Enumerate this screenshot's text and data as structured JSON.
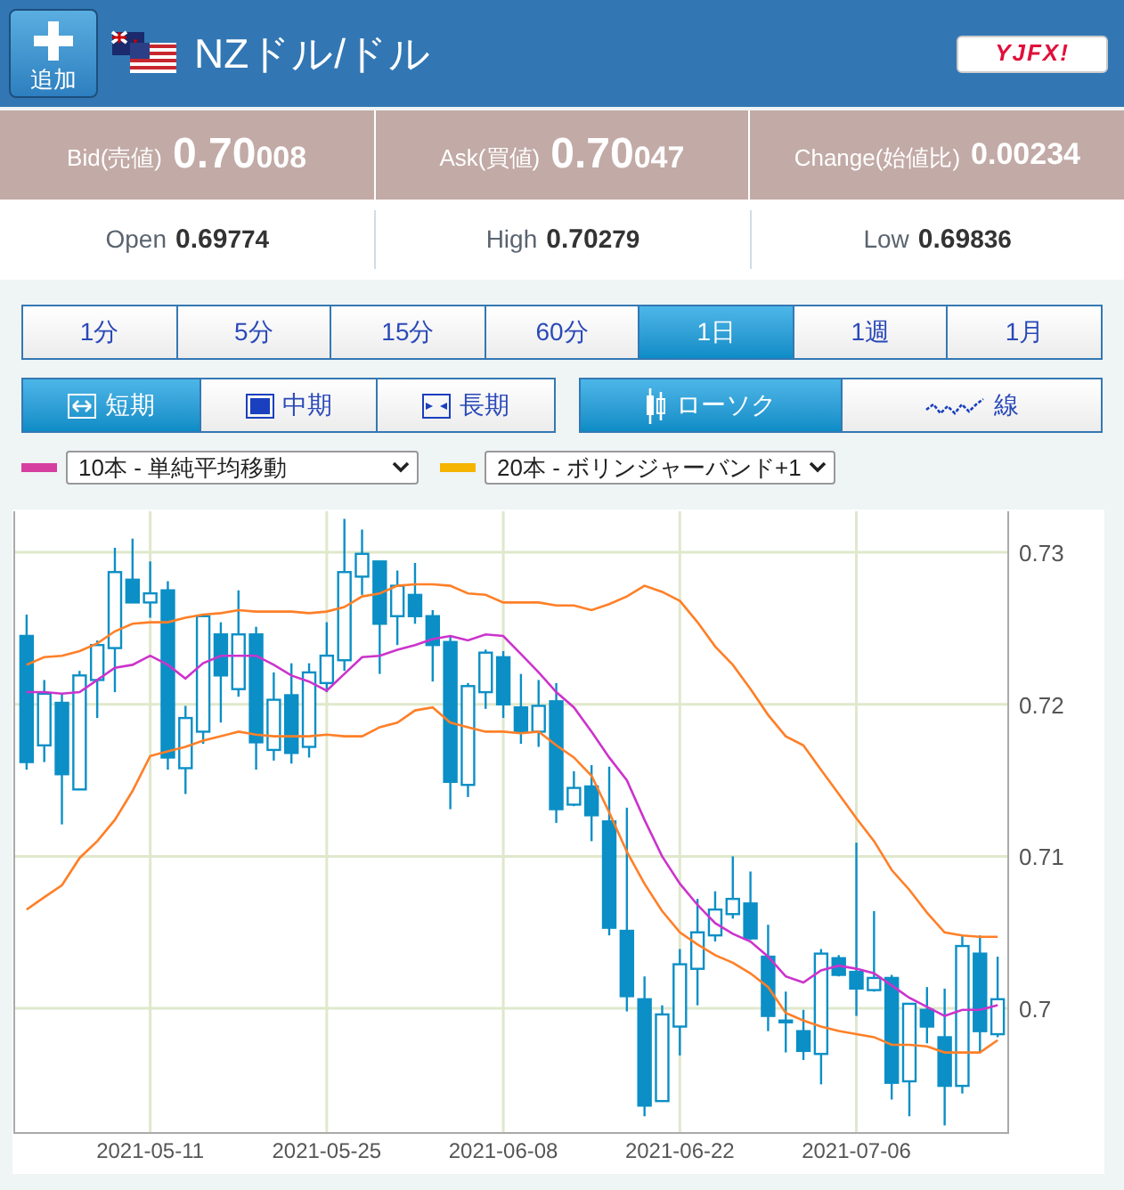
{
  "header": {
    "add_button": "追加",
    "title": "NZドル/ドル",
    "logo": "YJFX!"
  },
  "quotes": [
    {
      "label": "Bid(売値)",
      "value": "0.70",
      "value_small": "008"
    },
    {
      "label": "Ask(買値)",
      "value": "0.70",
      "value_small": "047"
    },
    {
      "label": "Change(始値比)",
      "value": "0.00234"
    }
  ],
  "stats": [
    {
      "label": "Open",
      "value": "0.69",
      "value_small": "774"
    },
    {
      "label": "High",
      "value": "0.70",
      "value_small": "279"
    },
    {
      "label": "Low",
      "value": "0.69",
      "value_small": "836"
    }
  ],
  "periods": [
    {
      "label": "1分",
      "selected": false
    },
    {
      "label": "5分",
      "selected": false
    },
    {
      "label": "15分",
      "selected": false
    },
    {
      "label": "60分",
      "selected": false
    },
    {
      "label": "1日",
      "selected": true
    },
    {
      "label": "1週",
      "selected": false
    },
    {
      "label": "1月",
      "selected": false
    }
  ],
  "ranges": [
    {
      "label": "短期",
      "kind": "short",
      "selected": true
    },
    {
      "label": "中期",
      "kind": "medium",
      "selected": false
    },
    {
      "label": "長期",
      "kind": "long",
      "selected": false
    }
  ],
  "chart_types": [
    {
      "label": "ローソク",
      "kind": "candle",
      "selected": true
    },
    {
      "label": "線",
      "kind": "line",
      "selected": false
    }
  ],
  "indicators": [
    {
      "color": "#d63fa0",
      "value": "10本 - 単純平均移動"
    },
    {
      "color": "#f5b400",
      "value": "20本 - ボリンジャーバンド+1"
    }
  ],
  "chart": {
    "chart_data": {
      "type": "candlestick",
      "categories": [
        null,
        null,
        null,
        null,
        null,
        null,
        null,
        "2021-05-11",
        null,
        null,
        null,
        null,
        null,
        null,
        null,
        null,
        null,
        "2021-05-25",
        null,
        null,
        null,
        null,
        null,
        null,
        null,
        null,
        null,
        "2021-06-08",
        null,
        null,
        null,
        null,
        null,
        null,
        null,
        null,
        null,
        "2021-06-22",
        null,
        null,
        null,
        null,
        null,
        null,
        null,
        null,
        null,
        "2021-07-06",
        null,
        null,
        null,
        null,
        null,
        null,
        null,
        null
      ],
      "ylim": [
        0.6918,
        0.7327
      ],
      "grid": true,
      "yticks": [
        0.7,
        0.71,
        0.72,
        0.73
      ],
      "ohlc": [
        [
          0.7245,
          0.7259,
          0.7157,
          0.7162
        ],
        [
          0.7173,
          0.7216,
          0.7162,
          0.7207
        ],
        [
          0.7201,
          0.7207,
          0.7121,
          0.7154
        ],
        [
          0.7144,
          0.7222,
          0.7144,
          0.7219
        ],
        [
          0.7216,
          0.7242,
          0.7191,
          0.7239
        ],
        [
          0.7237,
          0.7303,
          0.7208,
          0.7287
        ],
        [
          0.7282,
          0.7309,
          0.7267,
          0.7267
        ],
        [
          0.7267,
          0.7294,
          0.7257,
          0.7273
        ],
        [
          0.7275,
          0.7281,
          0.7157,
          0.7165
        ],
        [
          0.7158,
          0.7199,
          0.7141,
          0.7191
        ],
        [
          0.7182,
          0.7259,
          0.7174,
          0.7258
        ],
        [
          0.7246,
          0.7254,
          0.7188,
          0.7219
        ],
        [
          0.721,
          0.7275,
          0.7205,
          0.7246
        ],
        [
          0.7246,
          0.7251,
          0.7157,
          0.7175
        ],
        [
          0.717,
          0.7221,
          0.7163,
          0.7203
        ],
        [
          0.7206,
          0.7227,
          0.7161,
          0.7168
        ],
        [
          0.7172,
          0.7227,
          0.7165,
          0.7221
        ],
        [
          0.7214,
          0.7254,
          0.7208,
          0.7232
        ],
        [
          0.7229,
          0.7322,
          0.7222,
          0.7287
        ],
        [
          0.7284,
          0.7315,
          0.7272,
          0.7299
        ],
        [
          0.7294,
          0.7294,
          0.722,
          0.7253
        ],
        [
          0.7258,
          0.7288,
          0.7239,
          0.7278
        ],
        [
          0.7272,
          0.7293,
          0.7253,
          0.7258
        ],
        [
          0.7258,
          0.7262,
          0.7215,
          0.7239
        ],
        [
          0.7241,
          0.7245,
          0.7131,
          0.7149
        ],
        [
          0.7147,
          0.7214,
          0.7139,
          0.7212
        ],
        [
          0.7208,
          0.7236,
          0.7197,
          0.7234
        ],
        [
          0.7231,
          0.7235,
          0.7191,
          0.72
        ],
        [
          0.7198,
          0.722,
          0.7174,
          0.7182
        ],
        [
          0.7182,
          0.7216,
          0.7172,
          0.7199
        ],
        [
          0.7202,
          0.7214,
          0.7122,
          0.7131
        ],
        [
          0.7134,
          0.7156,
          0.7133,
          0.7145
        ],
        [
          0.7146,
          0.716,
          0.711,
          0.7127
        ],
        [
          0.7123,
          0.7159,
          0.7048,
          0.7053
        ],
        [
          0.7051,
          0.7132,
          0.6998,
          0.7008
        ],
        [
          0.7006,
          0.7021,
          0.6929,
          0.6936
        ],
        [
          0.6939,
          0.7002,
          0.6939,
          0.6996
        ],
        [
          0.6988,
          0.7039,
          0.6969,
          0.7029
        ],
        [
          0.7026,
          0.7072,
          0.7002,
          0.705
        ],
        [
          0.7048,
          0.7077,
          0.7044,
          0.7065
        ],
        [
          0.7062,
          0.71,
          0.7059,
          0.7072
        ],
        [
          0.7069,
          0.709,
          0.7045,
          0.7046
        ],
        [
          0.7034,
          0.7055,
          0.6985,
          0.6995
        ],
        [
          0.6992,
          0.7011,
          0.6971,
          0.6992
        ],
        [
          0.6985,
          0.6999,
          0.6966,
          0.6972
        ],
        [
          0.697,
          0.7039,
          0.695,
          0.7036
        ],
        [
          0.7033,
          0.7035,
          0.7021,
          0.7022
        ],
        [
          0.7024,
          0.7109,
          0.6995,
          0.7013
        ],
        [
          0.7012,
          0.7064,
          0.7011,
          0.702
        ],
        [
          0.702,
          0.7022,
          0.694,
          0.6951
        ],
        [
          0.6952,
          0.7003,
          0.6929,
          0.7003
        ],
        [
          0.6999,
          0.7014,
          0.6977,
          0.6988
        ],
        [
          0.6981,
          0.7013,
          0.6923,
          0.6949
        ],
        [
          0.6949,
          0.7048,
          0.6944,
          0.7041
        ],
        [
          0.7036,
          0.7048,
          0.6971,
          0.6985
        ],
        [
          0.6983,
          0.7034,
          0.6981,
          0.7006
        ]
      ],
      "series": [
        {
          "type": "line",
          "color": "#cc33cc",
          "values": [
            0.7208,
            0.7208,
            0.7207,
            0.7208,
            0.7216,
            0.7224,
            0.7226,
            0.7232,
            0.7226,
            0.7217,
            0.7227,
            0.7232,
            0.7232,
            0.7232,
            0.7226,
            0.7219,
            0.7215,
            0.7209,
            0.722,
            0.7231,
            0.7232,
            0.7236,
            0.7239,
            0.7243,
            0.7245,
            0.7242,
            0.7246,
            0.7245,
            0.7233,
            0.7221,
            0.7208,
            0.7198,
            0.7182,
            0.7165,
            0.715,
            0.7124,
            0.71,
            0.7082,
            0.7068,
            0.7056,
            0.7049,
            0.7044,
            0.7034,
            0.7021,
            0.7017,
            0.7025,
            0.7028,
            0.7026,
            0.7023,
            0.7015,
            0.7007,
            0.7001,
            0.6995,
            0.6999,
            0.6999,
            0.7002
          ]
        },
        {
          "type": "line",
          "color": "#ff7f27",
          "values": [
            0.7226,
            0.7231,
            0.7232,
            0.7235,
            0.724,
            0.7248,
            0.7253,
            0.7254,
            0.7254,
            0.7257,
            0.7259,
            0.726,
            0.7262,
            0.7261,
            0.7261,
            0.7261,
            0.726,
            0.7261,
            0.7264,
            0.7271,
            0.7273,
            0.7278,
            0.7279,
            0.7279,
            0.7278,
            0.7273,
            0.7272,
            0.7267,
            0.7267,
            0.7267,
            0.7265,
            0.7265,
            0.7262,
            0.7266,
            0.7271,
            0.7278,
            0.7274,
            0.7268,
            0.7254,
            0.7238,
            0.7226,
            0.721,
            0.7193,
            0.7179,
            0.7173,
            0.7157,
            0.7141,
            0.7125,
            0.711,
            0.7091,
            0.7078,
            0.7063,
            0.705,
            0.7048,
            0.7047,
            0.7047
          ]
        },
        {
          "type": "line",
          "color": "#ff7f27",
          "values": [
            0.7065,
            0.7073,
            0.7081,
            0.7099,
            0.711,
            0.7124,
            0.7143,
            0.7166,
            0.7169,
            0.7172,
            0.7176,
            0.7179,
            0.7182,
            0.718,
            0.7179,
            0.7179,
            0.7179,
            0.718,
            0.7179,
            0.7179,
            0.7185,
            0.7188,
            0.7196,
            0.7198,
            0.7188,
            0.7185,
            0.7182,
            0.7182,
            0.7181,
            0.7182,
            0.7173,
            0.7165,
            0.7153,
            0.7129,
            0.7103,
            0.7082,
            0.7064,
            0.705,
            0.7042,
            0.7035,
            0.703,
            0.7023,
            0.7014,
            0.6997,
            0.6992,
            0.6988,
            0.6985,
            0.6983,
            0.6981,
            0.6976,
            0.6976,
            0.6975,
            0.6971,
            0.6971,
            0.6971,
            0.6979
          ]
        }
      ]
    }
  }
}
